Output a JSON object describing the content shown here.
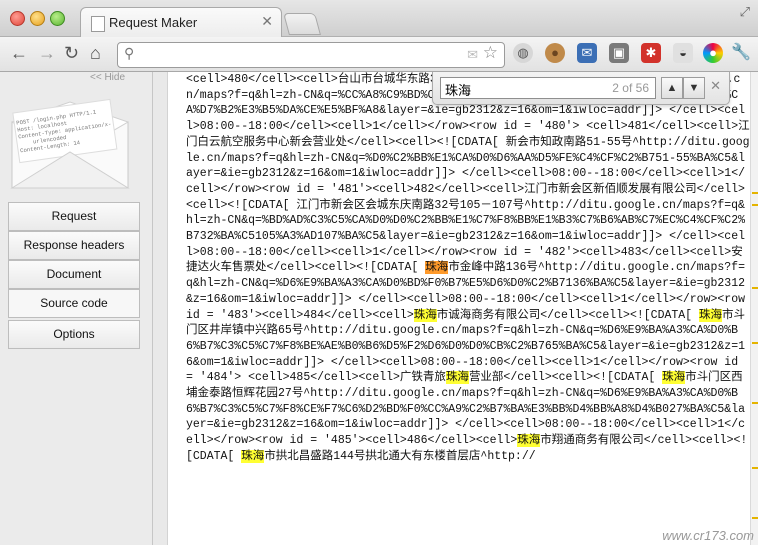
{
  "window": {
    "tab_title": "Request Maker"
  },
  "toolbar": {
    "url": ""
  },
  "sidebar": {
    "hide_label": "<< Hide",
    "envelope_text": [
      "POST /login.php HTTP/1.1",
      "Host: localhost",
      "Content-Type: application/x-",
      "urlencoded",
      "Content-Length: 14"
    ],
    "nav": [
      "Request",
      "Response headers",
      "Document",
      "Source code",
      "Options"
    ],
    "active": "Source code"
  },
  "find": {
    "query": "珠海",
    "count": "2 of 56"
  },
  "colors": {
    "highlight": "#ffff33",
    "current_highlight": "#ff9a2a"
  },
  "source_segments": [
    {
      "t": "<cell>480</cell><cell>台山市台城华东路35号台城桥湖路43号首层第五卡^http://ditu.google.cn/maps?f=q&hl=zh-CN&q=%CC%A8%C9%BD%CA%D0%CC%A8%B3%C7%C7%C5%BA%FE%C2%B743%BA%C5%CA%D7%B2%E3%B5%DA%CE%E5%BF%A8&layer=&ie=gb2312&z=16&om=1&iwloc=addr]]> </cell><cell>08:00--18:00</cell><cell>1</cell></row><row id = '480'> <cell>481</cell><cell>江门白云航空服务中心新会营业处</cell><cell><![CDATA[ 新会市知政南路51-55号^http://ditu.google.cn/maps?f=q&hl=zh-CN&q=%D0%C2%BB%E1%CA%D0%D6%AA%D5%FE%C4%CF%C2%B751-55%BA%C5&layer=&ie=gb2312&z=16&om=1&iwloc=addr]]> </cell><cell>08:00--18:00</cell><cell>1</cell></row><row id = '481'><cell>482</cell><cell>江门市新会区新佰顺发展有限公司</cell><cell><![CDATA[ 江门市新会区会城东庆南路32号105－107号^http://ditu.google.cn/maps?f=q&hl=zh-CN&q=%BD%AD%C3%C5%CA%D0%D0%C2%BB%E1%C7%F8%BB%E1%B3%C7%B6%AB%C7%EC%C4%CF%C2%B732%BA%C5105%A3%AD107%BA%C5&layer=&ie=gb2312&z=16&om=1&iwloc=addr]]> </cell><cell>08:00--18:00</cell><cell>1</cell></row><row id = '482'><cell>483</cell><cell>安捷达火车售票处</cell><cell><![CDATA[ ",
      "h": 0
    },
    {
      "t": "珠海",
      "h": 2
    },
    {
      "t": "市金峰中路136号^http://ditu.google.cn/maps?f=q&hl=zh-CN&q=%D6%E9%BA%A3%CA%D0%BD%F0%B7%E5%D6%D0%C2%B7136%BA%C5&layer=&ie=gb2312&z=16&om=1&iwloc=addr]]> </cell><cell>08:00--18:00</cell><cell>1</cell></row><row id = '483'><cell>484</cell><cell>",
      "h": 0
    },
    {
      "t": "珠海",
      "h": 1
    },
    {
      "t": "市诚海商务有限公司</cell><cell><![CDATA[ ",
      "h": 0
    },
    {
      "t": "珠海",
      "h": 1
    },
    {
      "t": "市斗门区井岸镇中兴路65号^http://ditu.google.cn/maps?f=q&hl=zh-CN&q=%D6%E9%BA%A3%CA%D0%B6%B7%C3%C5%C7%F8%BE%AE%B0%B6%D5%F2%D6%D0%D0%CB%C2%B765%BA%C5&layer=&ie=gb2312&z=16&om=1&iwloc=addr]]> </cell><cell>08:00--18:00</cell><cell>1</cell></row><row id = '484'> <cell>485</cell><cell>广铁青旅",
      "h": 0
    },
    {
      "t": "珠海",
      "h": 1
    },
    {
      "t": "营业部</cell><cell><![CDATA[ ",
      "h": 0
    },
    {
      "t": "珠海",
      "h": 1
    },
    {
      "t": "市斗门区西埔金泰路恒辉花园27号^http://ditu.google.cn/maps?f=q&hl=zh-CN&q=%D6%E9%BA%A3%CA%D0%B6%B7%C3%C5%C7%F8%CE%F7%C6%D2%BD%F0%CC%A9%C2%B7%BA%E3%BB%D4%BB%A8%D4%B027%BA%C5&layer=&ie=gb2312&z=16&om=1&iwloc=addr]]> </cell><cell>08:00--18:00</cell><cell>1</cell></row><row id = '485'><cell>486</cell><cell>",
      "h": 0
    },
    {
      "t": "珠海",
      "h": 1
    },
    {
      "t": "市翔通商务有限公司</cell><cell><![CDATA[ ",
      "h": 0
    },
    {
      "t": "珠海",
      "h": 1
    },
    {
      "t": "市拱北昌盛路144号拱北通大有东楼首层店^http://",
      "h": 0
    }
  ],
  "watermark": "www.cr173.com"
}
